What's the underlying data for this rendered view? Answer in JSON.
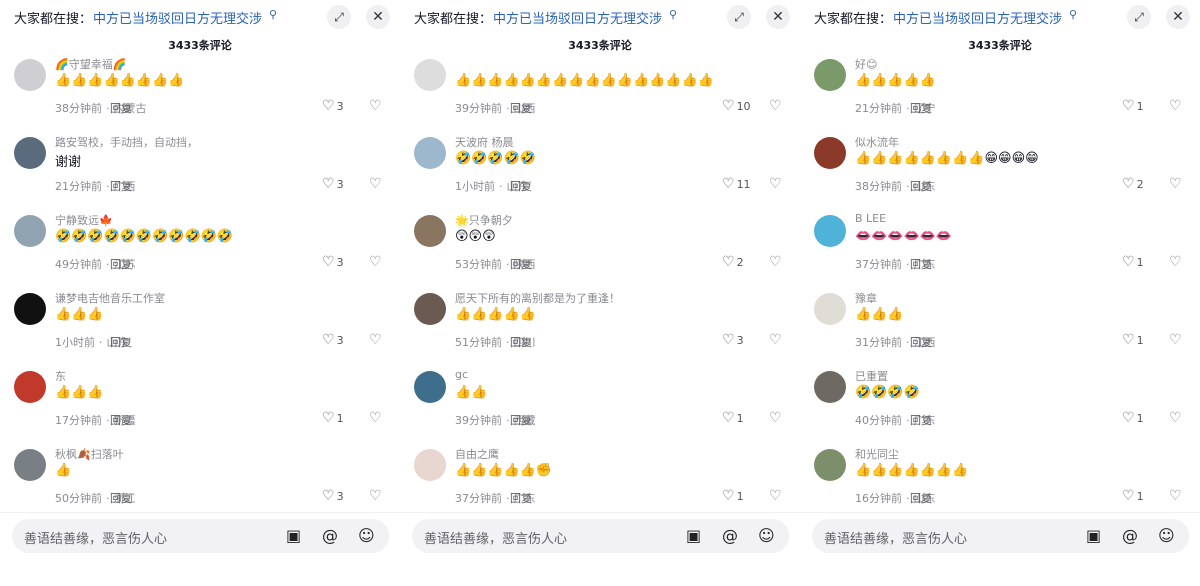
{
  "panels": [
    {
      "search_prefix": "大家都在搜：",
      "search_query": "中方已当场驳回日方无理交涉",
      "comment_count": "3433条评论",
      "comments": [
        {
          "name": "🌈守望幸福🌈",
          "text": "👍👍👍👍👍👍👍👍",
          "time": "38分钟前",
          "location": "内蒙古",
          "likes": "3",
          "avatar": "#cfcfd3"
        },
        {
          "name": "路安驾校，手动挡，自动挡，",
          "text": "谢谢",
          "time": "21分钟前",
          "location": "广西",
          "likes": "3",
          "avatar": "#5a6b7e"
        },
        {
          "name": "宁静致远🍁",
          "text": "🤣🤣🤣🤣🤣🤣🤣🤣🤣🤣🤣",
          "time": "49分钟前",
          "location": "江苏",
          "likes": "3",
          "avatar": "#8fa3b0"
        },
        {
          "name": "谦梦电吉他音乐工作室",
          "text": "👍👍👍",
          "time": "1小时前",
          "location": "山东",
          "likes": "3",
          "avatar": "#111111"
        },
        {
          "name": "东",
          "text": "👍👍👍",
          "time": "17分钟前",
          "location": "新疆",
          "likes": "1",
          "avatar": "#c0392b"
        },
        {
          "name": "秋枫🍂扫落叶",
          "text": "👍",
          "time": "50分钟前",
          "location": "浙江",
          "likes": "3",
          "avatar": "#7a7f86"
        }
      ],
      "reply_label": "回复",
      "input_placeholder": "善语结善缘，恶言伤人心"
    },
    {
      "search_prefix": "大家都在搜：",
      "search_query": "中方已当场驳回日方无理交涉",
      "comment_count": "3433条评论",
      "comments": [
        {
          "name": "",
          "text": "👍👍👍👍👍👍👍👍👍👍👍👍👍👍👍👍",
          "time": "39分钟前",
          "location": "山西",
          "likes": "10",
          "avatar": "#dddddd"
        },
        {
          "name": "天波府 杨晨",
          "text": "🤣🤣🤣🤣🤣",
          "time": "1小时前",
          "location": "山东",
          "likes": "11",
          "avatar": "#9db8cc"
        },
        {
          "name": "🌟只争朝夕",
          "text": "😲😲😲",
          "time": "53分钟前",
          "location": "陕西",
          "likes": "2",
          "avatar": "#8a7560"
        },
        {
          "name": "愿天下所有的离别都是为了重逢！",
          "text": "👍👍👍👍👍",
          "time": "51分钟前",
          "location": "四川",
          "likes": "3",
          "avatar": "#6b5a52"
        },
        {
          "name": "gc",
          "text": "👍👍",
          "time": "39分钟前",
          "location": "西藏",
          "likes": "1",
          "avatar": "#3f6e8c"
        },
        {
          "name": "自由之鹰",
          "text": "👍👍👍👍👍✊",
          "time": "37分钟前",
          "location": "广东",
          "likes": "1",
          "avatar": "#e8d6d0"
        }
      ],
      "reply_label": "回复",
      "input_placeholder": "善语结善缘，恶言伤人心"
    },
    {
      "search_prefix": "大家都在搜：",
      "search_query": "中方已当场驳回日方无理交涉",
      "comment_count": "3433条评论",
      "comments": [
        {
          "name": "好😊",
          "text": "👍👍👍👍👍",
          "time": "21分钟前",
          "location": "辽宁",
          "likes": "1",
          "avatar": "#7a9a6a"
        },
        {
          "name": "似水流年",
          "text": "👍👍👍👍👍👍👍👍😁😁😁😁",
          "time": "38分钟前",
          "location": "山东",
          "likes": "2",
          "avatar": "#8b3a2a"
        },
        {
          "name": "B LEE",
          "text": "👄👄👄👄👄👄",
          "time": "37分钟前",
          "location": "广东",
          "likes": "1",
          "avatar": "#4fb3d9"
        },
        {
          "name": "豫章",
          "text": "👍👍👍",
          "time": "31分钟前",
          "location": "江西",
          "likes": "1",
          "avatar": "#e0dcd6"
        },
        {
          "name": "已重置",
          "text": "🤣🤣🤣🤣",
          "time": "40分钟前",
          "location": "广东",
          "likes": "1",
          "avatar": "#6e6a63"
        },
        {
          "name": "和光同尘",
          "text": "👍👍👍👍👍👍👍",
          "time": "16分钟前",
          "location": "山东",
          "likes": "1",
          "avatar": "#7c8f6a"
        }
      ],
      "reply_label": "回复",
      "input_placeholder": "善语结善缘，恶言伤人心"
    }
  ],
  "icons": {
    "search": "search-icon",
    "expand": "expand-icon",
    "close": "close-icon",
    "like": "heart-icon",
    "dislike": "broken-heart-icon",
    "image": "image-icon",
    "at": "at-icon",
    "emoji": "emoji-icon"
  }
}
